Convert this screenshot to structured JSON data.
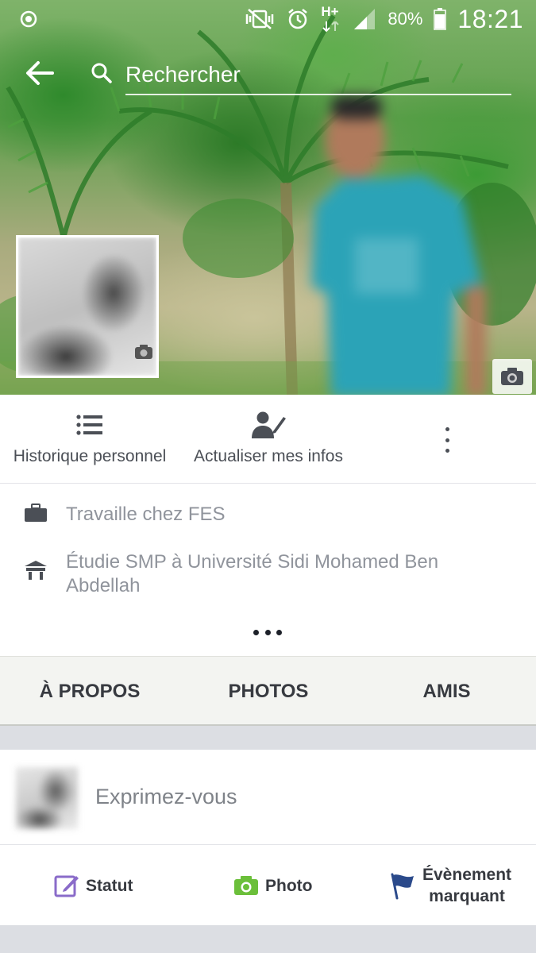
{
  "status_bar": {
    "battery_percent": "80%",
    "time": "18:21",
    "network_type": "H+",
    "icons": [
      "record-icon",
      "vibrate-mute-icon",
      "alarm-icon",
      "network-h-plus-icon",
      "signal-icon",
      "battery-icon"
    ]
  },
  "search": {
    "placeholder": "Rechercher"
  },
  "actions": {
    "history_label": "Historique personnel",
    "update_label": "Actualiser mes infos"
  },
  "info": {
    "work": "Travaille chez FES",
    "education": "Étudie SMP à Université Sidi Mohamed Ben Abdellah"
  },
  "tabs": {
    "about": "À PROPOS",
    "photos": "PHOTOS",
    "friends": "AMIS"
  },
  "composer": {
    "prompt": "Exprimez-vous"
  },
  "post_actions": {
    "status_label": "Statut",
    "photo_label": "Photo",
    "event_label_line1": "Évènement",
    "event_label_line2": "marquant"
  },
  "colors": {
    "status_icon_purple": "#8a6bc9",
    "photo_icon_green": "#6bbf3a",
    "event_flag_blue": "#2b4a8b",
    "text_gray": "#90949c",
    "tab_background": "#f3f4f1"
  }
}
